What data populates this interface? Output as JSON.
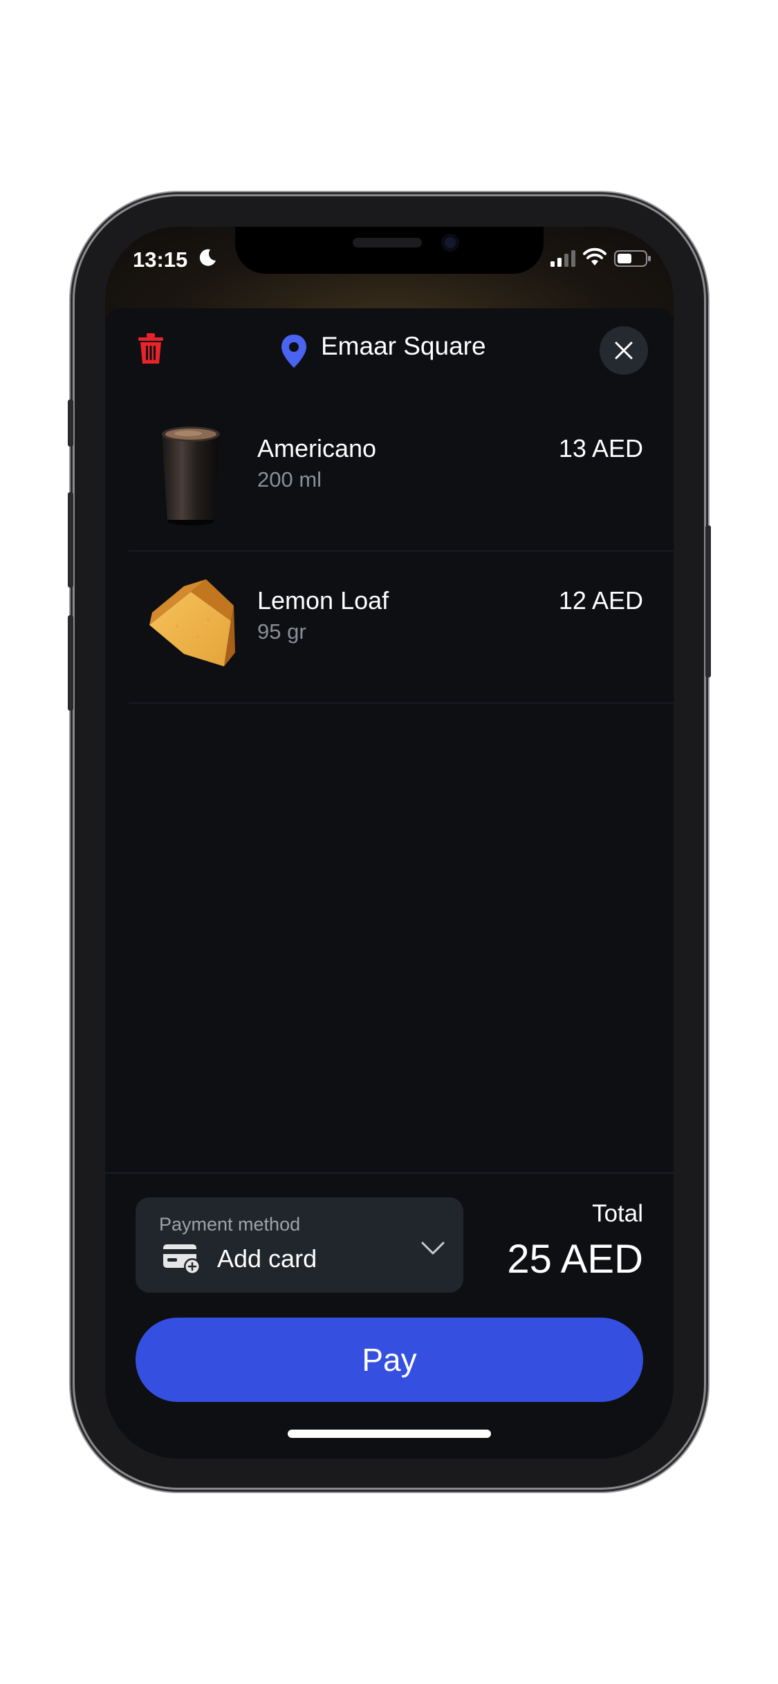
{
  "status_bar": {
    "time": "13:15"
  },
  "header": {
    "store_name": "Emaar Square"
  },
  "items": [
    {
      "name": "Americano",
      "size": "200 ml",
      "price": "13 AED"
    },
    {
      "name": "Lemon Loaf",
      "size": "95 gr",
      "price": "12 AED"
    }
  ],
  "payment": {
    "label": "Payment method",
    "value": "Add card"
  },
  "total": {
    "label": "Total",
    "value": "25 AED"
  },
  "pay_button": {
    "label": "Pay"
  },
  "colors": {
    "accent": "#3550e0",
    "delete": "#e8232a",
    "pin": "#4a63f0",
    "background": "#0d0f13"
  }
}
